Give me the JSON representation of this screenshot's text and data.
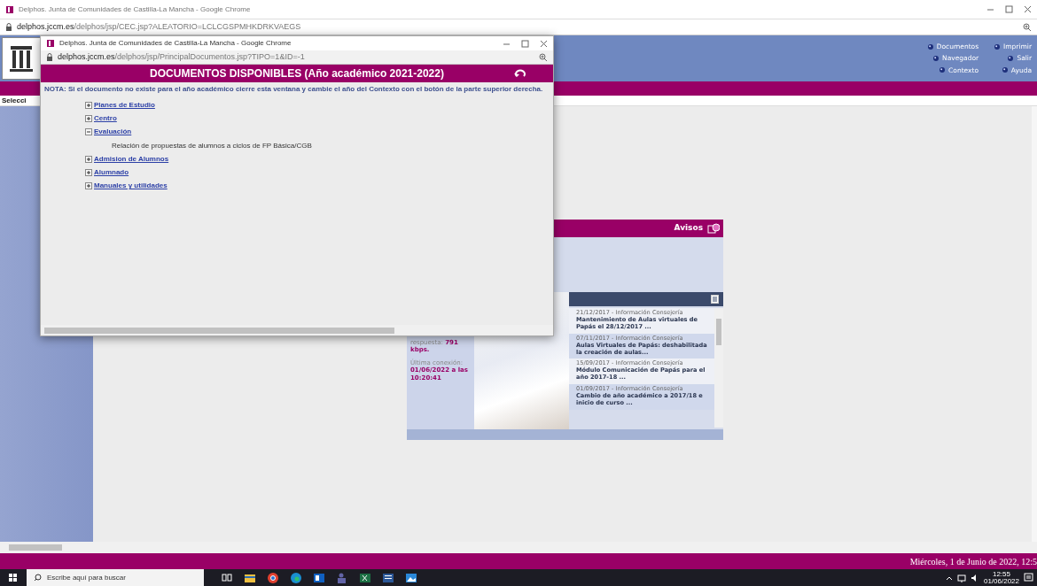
{
  "browser_window": {
    "title": "Delphos. Junta de Comunidades de Castilla-La Mancha - Google Chrome",
    "url_host": "delphos.jccm.es",
    "url_path": "/delphos/jsp/CEC.jsp?ALEATORIO=LCLCGSPMHKDRKVAEGS"
  },
  "header_menu": [
    {
      "label": "Documentos"
    },
    {
      "label": "Imprimir"
    },
    {
      "label": "Navegador"
    },
    {
      "label": "Salir"
    },
    {
      "label": "Contexto"
    },
    {
      "label": "Ayuda"
    }
  ],
  "selector_label": "Selecci",
  "avisos_panel": {
    "title": "Avisos"
  },
  "connection_info": {
    "speed_label": "respuesta:",
    "speed_value": "791 kbps.",
    "last_label": "Última conexión:",
    "last_value": "01/06/2022 a las 10:20:41"
  },
  "news": [
    {
      "date_source": "21/12/2017 - Información Consejería",
      "headline": "Mantenimiento de Aulas virtuales de Papás el 28/12/2017 ..."
    },
    {
      "date_source": "07/11/2017 - Información Consejería",
      "headline": "Aulas Virtuales de Papás: deshabilitada la creación de aulas..."
    },
    {
      "date_source": "15/09/2017 - Información Consejería",
      "headline": "Módulo Comunicación de Papás para el año 2017-18 ..."
    },
    {
      "date_source": "01/09/2017 - Información Consejería",
      "headline": "Cambio de año académico a 2017/18 e inicio de curso ..."
    }
  ],
  "status_bar": "Miércoles, 1 de Junio de 2022, 12:5",
  "popup_window": {
    "title": "Delphos. Junta de Comunidades de Castilla-La Mancha - Google Chrome",
    "url_host": "delphos.jccm.es",
    "url_path": "/delphos/jsp/PrincipalDocumentos.jsp?TIPO=1&ID=-1",
    "heading": "DOCUMENTOS DISPONIBLES (Año académico 2021-2022)",
    "note": "NOTA: Si el documento no existe para el año académico cierre esta ventana y cambie el año del Contexto con el botón de la parte superior derecha.",
    "tree": [
      {
        "label": "Planes de Estudio",
        "expanded": false
      },
      {
        "label": "Centro",
        "expanded": false
      },
      {
        "label": "Evaluación",
        "expanded": true,
        "children": [
          {
            "label": "Relación de propuestas de alumnos a ciclos de FP Básica/CGB"
          }
        ]
      },
      {
        "label": "Admision de Alumnos",
        "expanded": false
      },
      {
        "label": "Alumnado",
        "expanded": false
      },
      {
        "label": "Manuales y utilidades",
        "expanded": false
      }
    ]
  },
  "taskbar": {
    "search_placeholder": "Escribe aquí para buscar",
    "time": "12:55",
    "date": "01/06/2022"
  }
}
